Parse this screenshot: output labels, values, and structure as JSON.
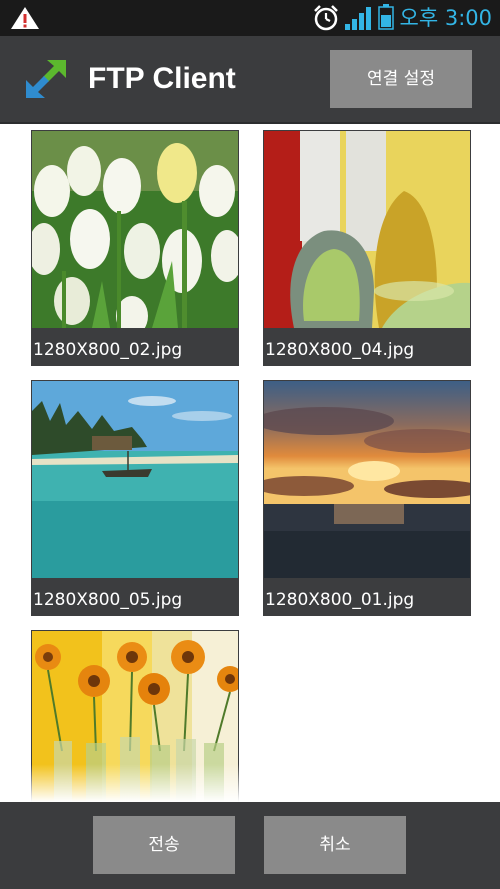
{
  "status_bar": {
    "time": "오후 3:00",
    "icons": [
      "warning-icon",
      "alarm-icon",
      "signal-icon",
      "battery-icon"
    ],
    "time_color": "#33b5e5"
  },
  "header": {
    "title": "FTP Client",
    "logo_icon": "ftp-transfer-arrows-icon",
    "connection_settings_label": "연결 설정"
  },
  "images": [
    {
      "filename": "1280X800_02.jpg",
      "thumb": "white-tulips"
    },
    {
      "filename": "1280X800_04.jpg",
      "thumb": "glass-vases"
    },
    {
      "filename": "1280X800_05.jpg",
      "thumb": "tropical-beach"
    },
    {
      "filename": "1280X800_01.jpg",
      "thumb": "ocean-sunset"
    },
    {
      "filename": "",
      "thumb": "sunflowers-in-vases"
    }
  ],
  "footer": {
    "send_label": "전송",
    "cancel_label": "취소"
  },
  "colors": {
    "bar_background": "#3b3c3e",
    "button_background": "#8a8a8a",
    "accent": "#33b5e5"
  }
}
